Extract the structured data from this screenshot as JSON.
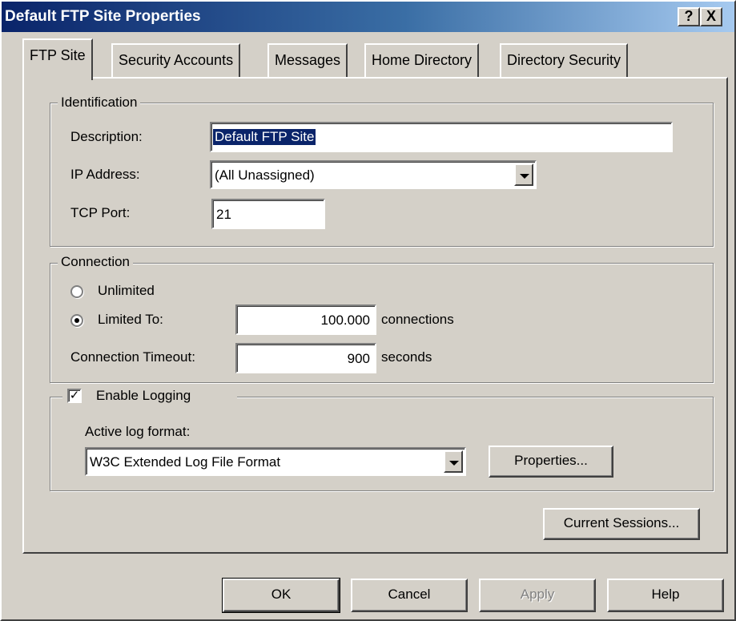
{
  "window": {
    "title": "Default FTP Site Properties",
    "help_glyph": "?",
    "close_glyph": "X"
  },
  "tabs": [
    {
      "label": "FTP Site",
      "active": true
    },
    {
      "label": "Security Accounts",
      "active": false
    },
    {
      "label": "Messages",
      "active": false
    },
    {
      "label": "Home Directory",
      "active": false
    },
    {
      "label": "Directory Security",
      "active": false
    }
  ],
  "identification": {
    "legend": "Identification",
    "description_label": "Description:",
    "description_value": "Default FTP Site",
    "ip_label": "IP Address:",
    "ip_value": "(All Unassigned)",
    "tcp_label": "TCP Port:",
    "tcp_value": "21"
  },
  "connection": {
    "legend": "Connection",
    "unlimited_label": "Unlimited",
    "limited_label": "Limited To:",
    "limited_selected": true,
    "limited_value": "100.000",
    "limited_unit": "connections",
    "timeout_label": "Connection Timeout:",
    "timeout_value": "900",
    "timeout_unit": "seconds"
  },
  "logging": {
    "checkbox_label": "Enable Logging",
    "checked": true,
    "check_glyph": "✓",
    "format_label": "Active log format:",
    "format_value": "W3C Extended Log File Format",
    "properties_button": "Properties..."
  },
  "current_sessions_button": "Current Sessions...",
  "footer": {
    "ok": "OK",
    "cancel": "Cancel",
    "apply": "Apply",
    "help": "Help"
  },
  "colors": {
    "title_bar": "#0a246a",
    "face": "#d4d0c8",
    "selection": "#0a246a"
  }
}
